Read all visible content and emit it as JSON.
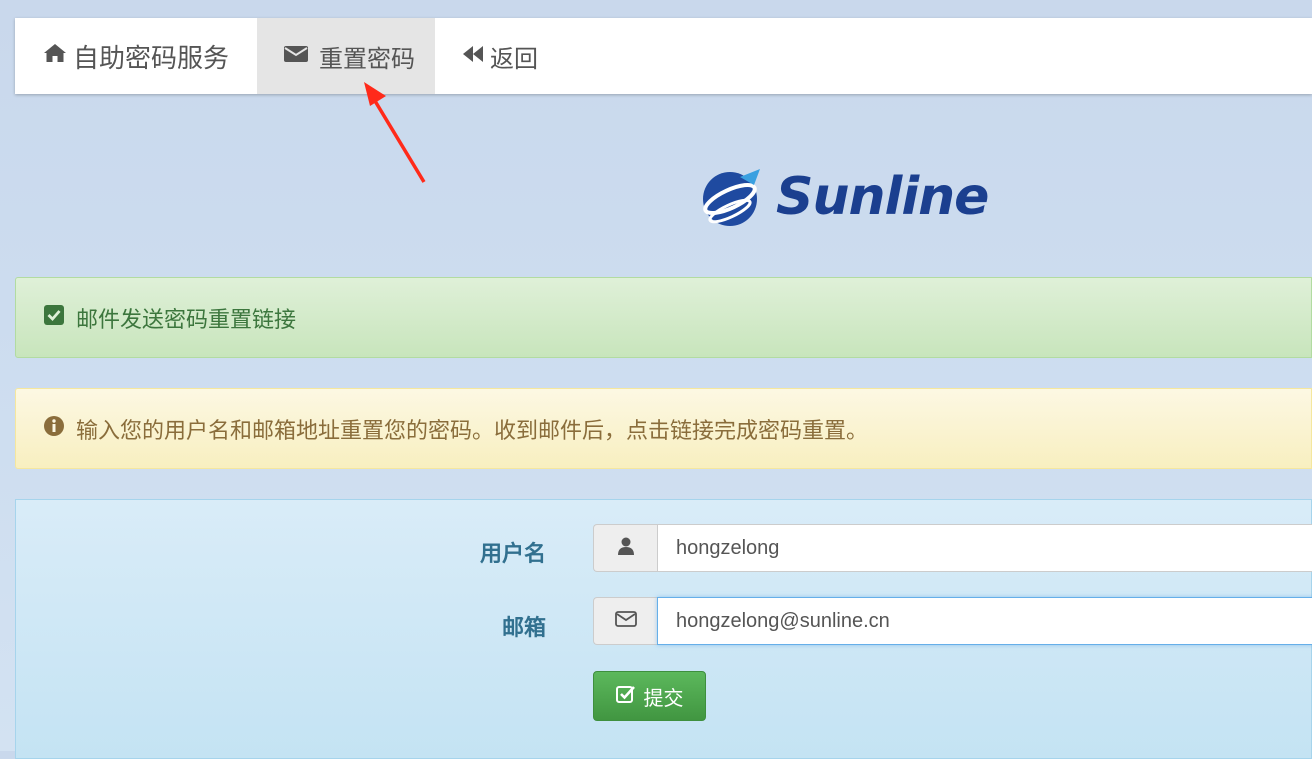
{
  "navbar": {
    "brand_label": "自助密码服务",
    "reset_label": "重置密码",
    "back_label": "返回"
  },
  "logo": {
    "text": "Sunline"
  },
  "alerts": {
    "success_text": "邮件发送密码重置链接",
    "info_text": "输入您的用户名和邮箱地址重置您的密码。收到邮件后，点击链接完成密码重置。"
  },
  "form": {
    "username_label": "用户名",
    "username_value": "hongzelong",
    "email_label": "邮箱",
    "email_value": "hongzelong@sunline.cn",
    "submit_label": "提交"
  },
  "colors": {
    "success": "#3c763d",
    "warning": "#8a6d3b",
    "info": "#31708f",
    "submit": "#5cb85c",
    "brand_blue": "#1b3f8f"
  },
  "icons": [
    "home-icon",
    "envelope-icon",
    "backward-icon",
    "check-square-icon",
    "info-circle-icon",
    "user-icon",
    "envelope-outline-icon",
    "check-square-outline-icon"
  ]
}
